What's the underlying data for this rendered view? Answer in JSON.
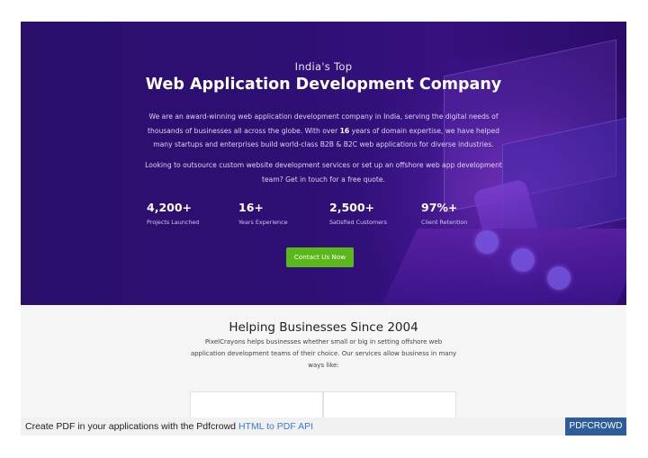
{
  "hero": {
    "pretitle": "India's Top",
    "title": "Web Application Development Company",
    "para1_pre": "We are an award-winning web application development company in India, serving the digital needs of thousands of businesses all across the globe. With over ",
    "para1_bold": "16",
    "para1_post": " years of domain expertise, we have helped many startups and enterprises build world-class B2B & B2C web applications for diverse industries.",
    "para2": "Looking to outsource custom website development services or set up an offshore web app development team? Get in touch for a free quote.",
    "stats": [
      {
        "value": "4,200+",
        "label": "Projects Launched"
      },
      {
        "value": "16+",
        "label": "Years Experience"
      },
      {
        "value": "2,500+",
        "label": "Satisfied Customers"
      },
      {
        "value": "97%+",
        "label": "Client Retention"
      }
    ],
    "cta_label": "Contact Us Now",
    "colors": {
      "background": "#2e0f74",
      "cta": "#5bb81b"
    }
  },
  "section": {
    "title": "Helping Businesses Since 2004",
    "subtitle": "PixelCrayons helps businesses whether small or big in setting offshore web application development teams of their choice. Our services allow business in many ways like:"
  },
  "footer": {
    "text": "Create PDF in your applications with the Pdfcrowd ",
    "link": "HTML to PDF API",
    "badge": "PDFCROWD",
    "colors": {
      "link": "#3a7bd5",
      "badge": "#2f5d9a"
    }
  }
}
